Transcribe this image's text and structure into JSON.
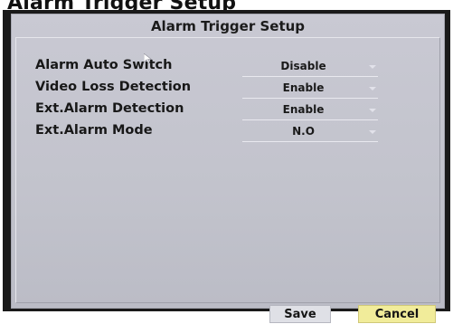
{
  "caption": "Alarm Trigger Setup",
  "dialog": {
    "title": "Alarm Trigger Setup",
    "settings": [
      {
        "label": "Alarm Auto Switch",
        "value": "Disable"
      },
      {
        "label": "Video Loss Detection",
        "value": "Enable"
      },
      {
        "label": "Ext.Alarm Detection",
        "value": "Enable"
      },
      {
        "label": "Ext.Alarm Mode",
        "value": "N.O"
      }
    ],
    "buttons": {
      "save": "Save",
      "cancel": "Cancel"
    }
  },
  "colors": {
    "panel": "#c6c7d0",
    "cancel_highlight": "#f1ec9a",
    "save_button": "#dfe0e6"
  }
}
